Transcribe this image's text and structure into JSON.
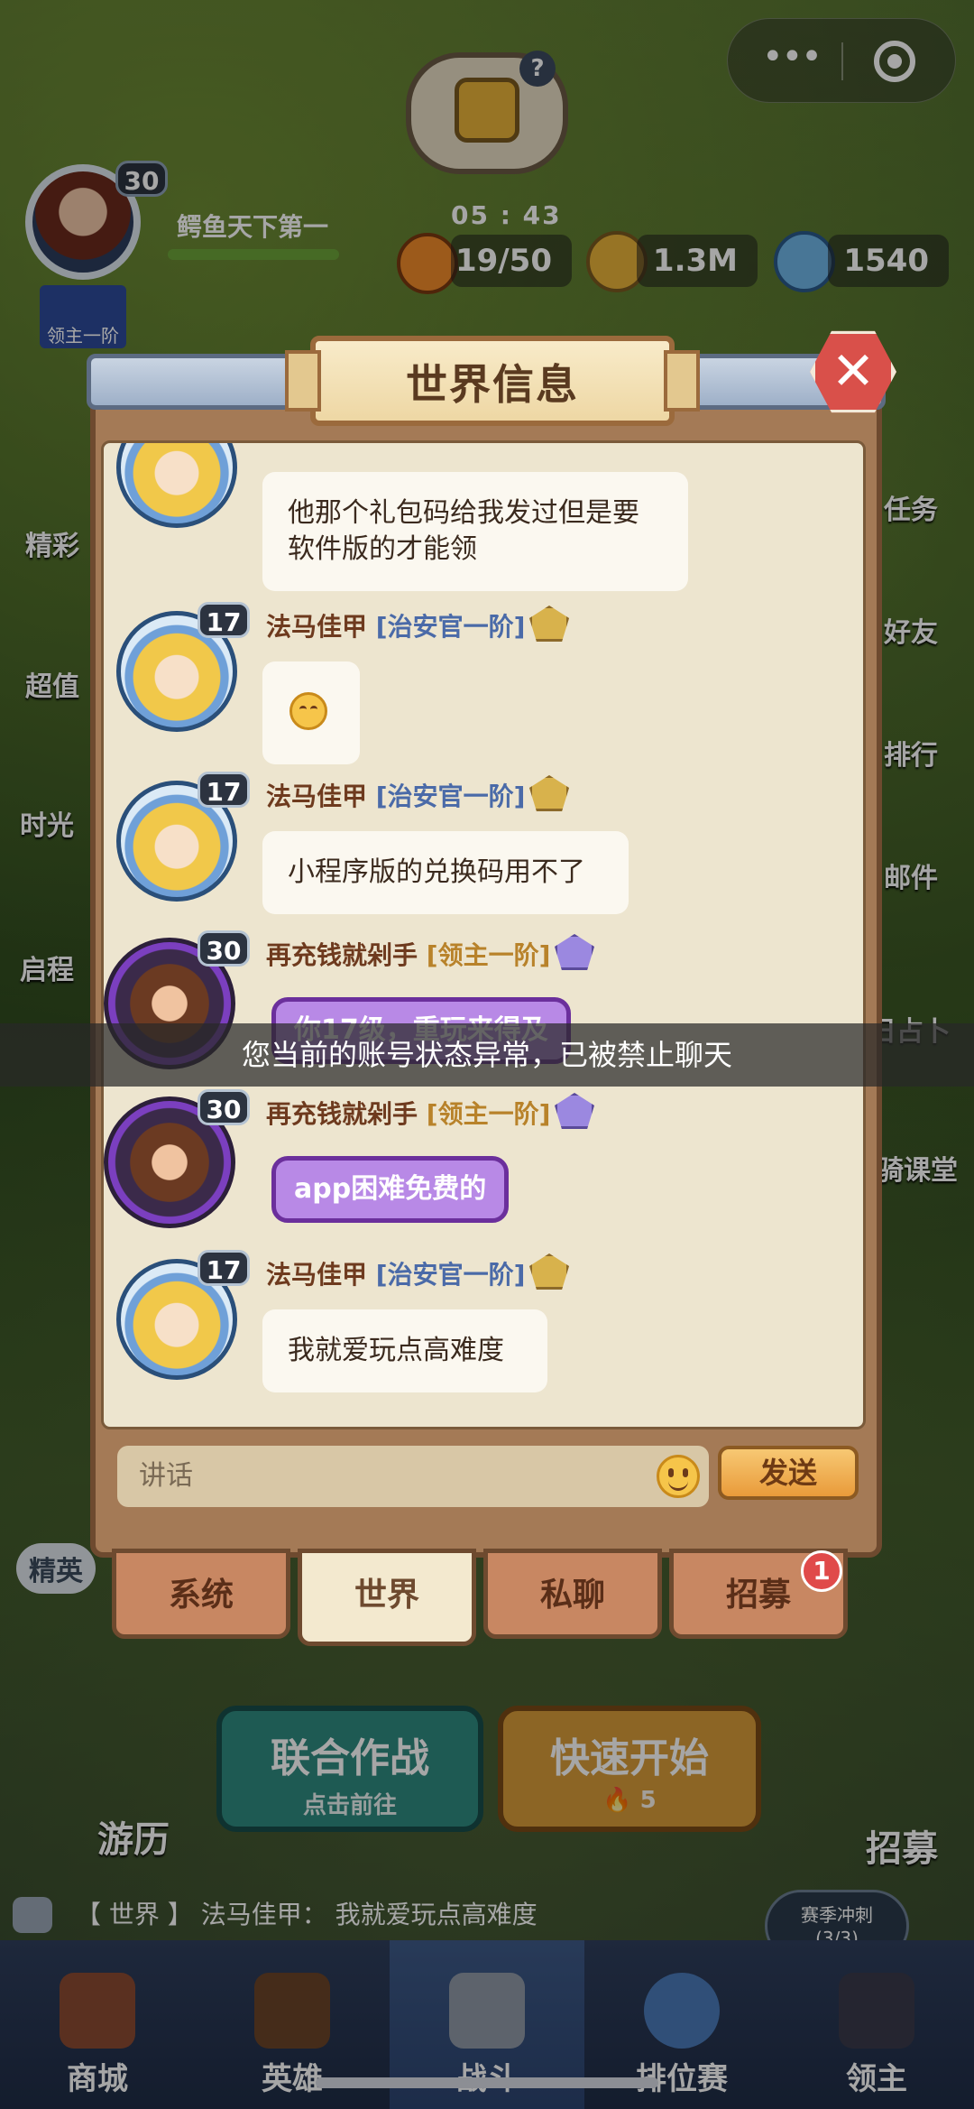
{
  "hud": {
    "timer": "05 : 43",
    "player_name": "鳄鱼天下第一",
    "player_level": "30",
    "player_rank": "领主一阶",
    "resources": {
      "stamina": "19/50",
      "gold": "1.3M",
      "crystal": "1540"
    },
    "capsule": {
      "more_icon": "more-dots-icon",
      "close_icon": "target-close-icon"
    }
  },
  "side_left": [
    "精彩",
    "超值",
    "时光",
    "启程",
    "精英"
  ],
  "side_right": [
    "任务",
    "好友",
    "排行",
    "邮件",
    "日占卜",
    "骑课堂"
  ],
  "dialog": {
    "title": "世界信息",
    "close_label": "✕"
  },
  "messages": [
    {
      "text_lines": [
        "他那个礼包码给我发过但是要",
        "软件版的才能领"
      ]
    },
    {
      "level": "17",
      "name": "法马佳甲",
      "title": "[治安官一阶]",
      "emoji": "relieved-face-emoji"
    },
    {
      "level": "17",
      "name": "法马佳甲",
      "title": "[治安官一阶]",
      "text": "小程序版的兑换码用不了"
    },
    {
      "level": "30",
      "name": "再充钱就剁手",
      "title": "[领主一阶]",
      "text": "你17级，重玩来得及"
    },
    {
      "level": "30",
      "name": "再充钱就剁手",
      "title": "[领主一阶]",
      "text": "app困难免费的"
    },
    {
      "level": "17",
      "name": "法马佳甲",
      "title": "[治安官一阶]",
      "text": "我就爱玩点高难度"
    }
  ],
  "toast": "您当前的账号状态异常，已被禁止聊天",
  "input": {
    "placeholder": "讲话",
    "send_label": "发送"
  },
  "tabs": [
    {
      "label": "系统",
      "active": false
    },
    {
      "label": "世界",
      "active": true
    },
    {
      "label": "私聊",
      "active": false
    },
    {
      "label": "招募",
      "active": false,
      "badge": "1"
    }
  ],
  "lower": {
    "coop_title": "联合作战",
    "coop_sub": "点击前往",
    "quick_title": "快速开始",
    "quick_cost": "5",
    "travel_label": "游历",
    "recruit_label": "招募"
  },
  "ticker": {
    "channel": "【 世界 】",
    "sender": "法马佳甲：",
    "text": "我就爱玩点高难度"
  },
  "season": {
    "line1": "赛季冲刺",
    "line2": "(3/3)"
  },
  "nav": [
    {
      "label": "商城",
      "active": false
    },
    {
      "label": "英雄",
      "active": false
    },
    {
      "label": "战斗",
      "active": true
    },
    {
      "label": "排位赛",
      "active": false
    },
    {
      "label": "领主",
      "active": false
    }
  ],
  "colors": {
    "dialog_wood": "#a47a56",
    "panel_paper": "#ede5cf",
    "name_brown": "#6e3a1e",
    "title_blue": "#4a6aa8",
    "title_gold": "#b8822a",
    "send_orange": "#e99b3a",
    "badge_red": "#e04a4a"
  }
}
